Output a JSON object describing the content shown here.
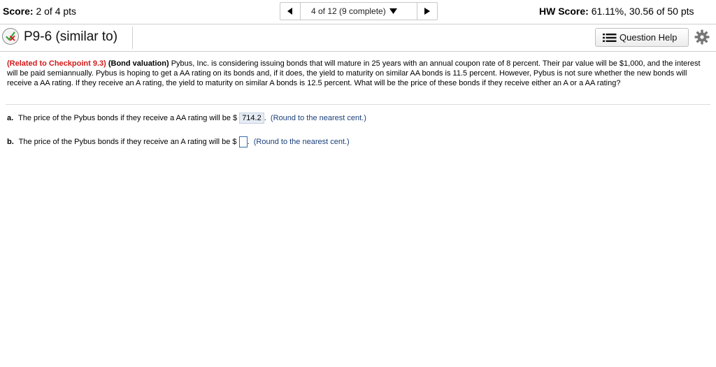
{
  "topbar": {
    "score_label": "Score:",
    "score_value": "2 of 4 pts",
    "nav_status": "4 of 12 (9 complete)",
    "hw_label": "HW Score:",
    "hw_value": "61.11%, 30.56 of 50 pts"
  },
  "question": {
    "title": "P9-6 (similar to)",
    "help_label": "Question Help",
    "icons": [
      "partial-credit-icon",
      "list-icon",
      "gear-icon",
      "chevron-left-icon",
      "chevron-right-icon",
      "caret-down-icon"
    ]
  },
  "problem": {
    "related": "(Related to Checkpoint 9.3)",
    "topic": "(Bond valuation)",
    "text": "Pybus, Inc. is considering issuing bonds that will mature in 25 years with an annual coupon rate of 8 percent. Their par value will be $1,000, and the interest will be paid semiannually. Pybus is hoping to get a AA rating on its bonds and, if it does, the yield to maturity on similar AA bonds is 11.5 percent. However, Pybus is not sure whether the new bonds will receive a AA rating. If they receive an A rating, the yield to maturity on similar A bonds is 12.5 percent. What will be the price of these bonds if they receive either an A or a AA rating?"
  },
  "parts": {
    "a": {
      "label": "a.",
      "text": "The price of the Pybus bonds if they receive a AA rating will be $",
      "answer": "714.2",
      "after": ".",
      "hint": "(Round to the nearest cent.)"
    },
    "b": {
      "label": "b.",
      "text": "The price of the Pybus bonds if they receive an A rating will be $",
      "answer": "",
      "after": ".",
      "hint": "(Round to the nearest cent.)"
    }
  },
  "colors": {
    "related": "#d21a1a",
    "hint": "#1a3f7a",
    "answer_bg": "#e6ecf4",
    "input_border": "#3a6ea8"
  }
}
